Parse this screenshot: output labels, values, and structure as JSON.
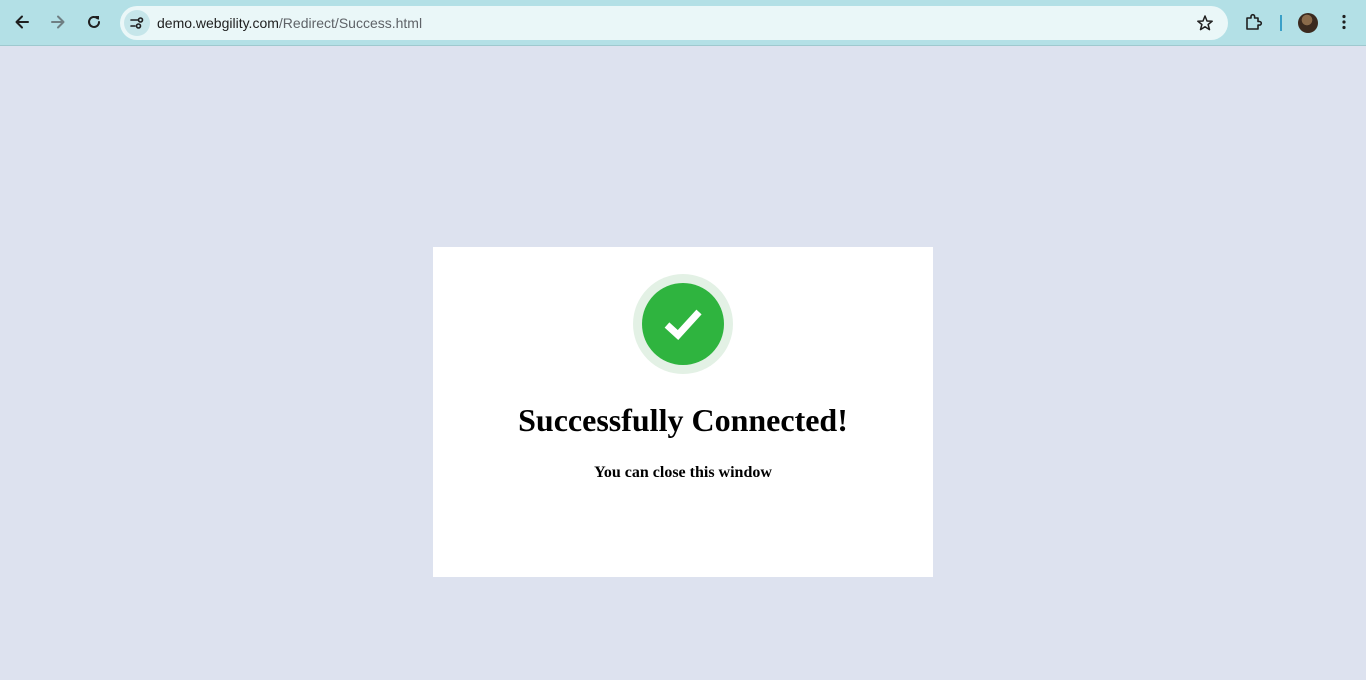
{
  "browser": {
    "url_domain": "demo.webgility.com",
    "url_path": "/Redirect/Success.html",
    "icons": {
      "back": "arrow-left-icon",
      "forward": "arrow-right-icon",
      "reload": "reload-icon",
      "site_info": "tune-icon",
      "bookmark": "star-icon",
      "extensions": "puzzle-icon",
      "menu": "kebab-menu-icon"
    },
    "colors": {
      "toolbar": "#b3e0e6",
      "omnibox": "#eaf7f8"
    }
  },
  "page": {
    "background": "#dde2ef",
    "card": {
      "icon": "checkmark-icon",
      "icon_color": "#2fb43f",
      "title": "Successfully Connected!",
      "subtitle": "You can close this window"
    }
  }
}
